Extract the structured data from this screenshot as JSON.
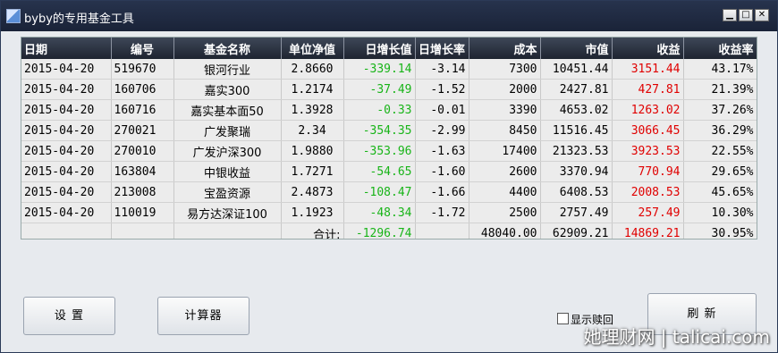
{
  "window": {
    "title": "byby的专用基金工具"
  },
  "titlebar_buttons": {
    "minimize": "▁",
    "maximize": "□",
    "close": "✕"
  },
  "table": {
    "headers": [
      "日期",
      "编号",
      "基金名称",
      "单位净值",
      "日增长值",
      "日增长率",
      "成本",
      "市值",
      "收益",
      "收益率"
    ],
    "rows": [
      [
        "2015-04-20",
        "519670",
        "银河行业",
        "2.8660",
        "-339.14",
        "-3.14",
        "7300",
        "10451.44",
        "3151.44",
        "43.17%"
      ],
      [
        "2015-04-20",
        "160706",
        "嘉实300",
        "1.2174",
        "-37.49",
        "-1.52",
        "2000",
        "2427.81",
        "427.81",
        "21.39%"
      ],
      [
        "2015-04-20",
        "160716",
        "嘉实基本面50",
        "1.3928",
        "-0.33",
        "-0.01",
        "3390",
        "4653.02",
        "1263.02",
        "37.26%"
      ],
      [
        "2015-04-20",
        "270021",
        "广发聚瑞",
        "2.34",
        "-354.35",
        "-2.99",
        "8450",
        "11516.45",
        "3066.45",
        "36.29%"
      ],
      [
        "2015-04-20",
        "270010",
        "广发沪深300",
        "1.9880",
        "-353.96",
        "-1.63",
        "17400",
        "21323.53",
        "3923.53",
        "22.55%"
      ],
      [
        "2015-04-20",
        "163804",
        "中银收益",
        "1.7271",
        "-54.65",
        "-1.60",
        "2600",
        "3370.94",
        "770.94",
        "29.65%"
      ],
      [
        "2015-04-20",
        "213008",
        "宝盈资源",
        "2.4873",
        "-108.47",
        "-1.66",
        "4400",
        "6408.53",
        "2008.53",
        "45.65%"
      ],
      [
        "2015-04-20",
        "110019",
        "易方达深证100",
        "1.1923",
        "-48.34",
        "-1.72",
        "2500",
        "2757.49",
        "257.49",
        "10.30%"
      ]
    ],
    "total": {
      "label": "合计:",
      "daily_change": "-1296.74",
      "cost": "48040.00",
      "market_value": "62909.21",
      "profit": "14869.21",
      "profit_rate": "30.95%"
    }
  },
  "buttons": {
    "settings": "设  置",
    "calculator": "计算器",
    "refresh": "刷  新"
  },
  "checkbox": {
    "label": "显示赎回",
    "checked": false
  },
  "watermark": "她理财网 | talicai.com",
  "colors": {
    "negative_change": "#18b418",
    "profit": "#e00000",
    "header_bg": "#2a3140"
  }
}
